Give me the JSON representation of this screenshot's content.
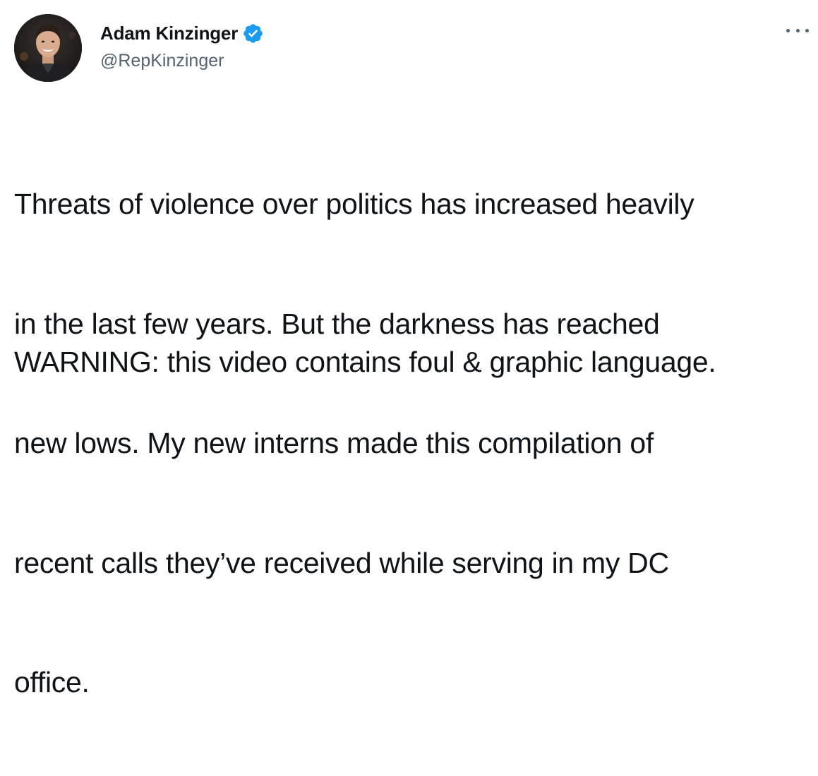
{
  "author": {
    "display_name": "Adam Kinzinger",
    "handle": "@RepKinzinger",
    "verified": true,
    "avatar_icon": "profile-photo"
  },
  "tweet": {
    "text_lines": [
      "Threats of violence over politics has increased heavily",
      "in the last few years. But the darkness has reached",
      "new lows. My new interns made this compilation of",
      "recent calls they’ve received while serving in my DC",
      "office."
    ],
    "warning": "WARNING: this video contains foul & graphic language."
  },
  "icons": {
    "verified": "verified-badge-icon",
    "more": "more-options-icon"
  },
  "colors": {
    "text_primary": "#0f1419",
    "text_secondary": "#536471",
    "verified_blue": "#1d9bf0",
    "background": "#ffffff"
  }
}
